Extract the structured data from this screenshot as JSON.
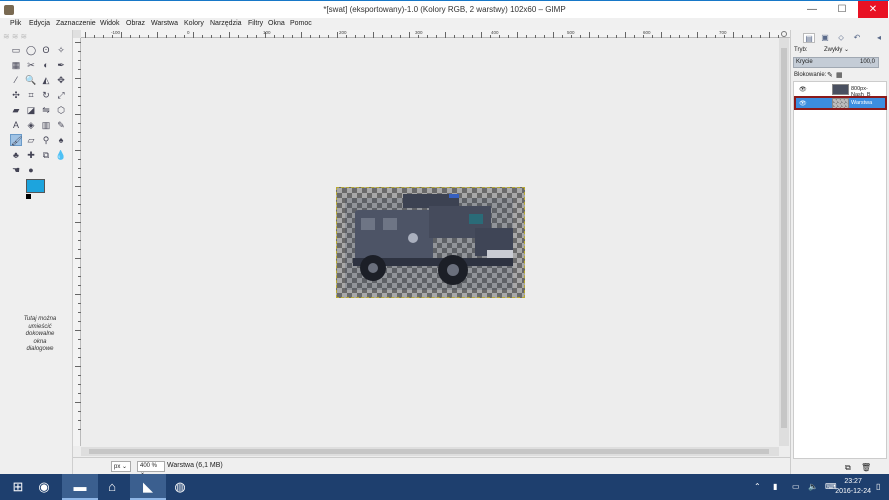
{
  "window": {
    "title": "*[swat] (eksportowany)-1.0 (Kolory RGB, 2 warstwy) 102x60 – GIMP",
    "minimize": "—",
    "maximize": "☐",
    "close": "✕"
  },
  "menu": [
    "Plik",
    "Edycja",
    "Zaznaczenie",
    "Widok",
    "Obraz",
    "Warstwa",
    "Kolory",
    "Narzędzia",
    "Filtry",
    "Okna",
    "Pomoc"
  ],
  "toolbox": {
    "tools": [
      {
        "name": "rect-select-icon",
        "glyph": "▭"
      },
      {
        "name": "ellipse-select-icon",
        "glyph": "◯"
      },
      {
        "name": "lasso-icon",
        "glyph": "ʘ"
      },
      {
        "name": "fuzzy-select-icon",
        "glyph": "✧"
      },
      {
        "name": "select-by-color-icon",
        "glyph": "▦"
      },
      {
        "name": "scissors-icon",
        "glyph": "✂"
      },
      {
        "name": "foreground-select-icon",
        "glyph": "◐"
      },
      {
        "name": "paths-icon",
        "glyph": "✒"
      },
      {
        "name": "color-picker-icon",
        "glyph": "⁄"
      },
      {
        "name": "zoom-icon",
        "glyph": "🔍"
      },
      {
        "name": "measure-icon",
        "glyph": "◭"
      },
      {
        "name": "move-icon",
        "glyph": "✥"
      },
      {
        "name": "align-icon",
        "glyph": "✣"
      },
      {
        "name": "crop-icon",
        "glyph": "⌗"
      },
      {
        "name": "rotate-icon",
        "glyph": "↻"
      },
      {
        "name": "scale-icon",
        "glyph": "⤢"
      },
      {
        "name": "shear-icon",
        "glyph": "▰"
      },
      {
        "name": "perspective-icon",
        "glyph": "◪"
      },
      {
        "name": "flip-icon",
        "glyph": "⇋"
      },
      {
        "name": "cage-icon",
        "glyph": "⬡"
      },
      {
        "name": "text-icon",
        "glyph": "A"
      },
      {
        "name": "bucket-fill-icon",
        "glyph": "◈"
      },
      {
        "name": "gradient-icon",
        "glyph": "▥"
      },
      {
        "name": "pencil-icon",
        "glyph": "✎"
      },
      {
        "name": "paintbrush-icon",
        "glyph": "🖌"
      },
      {
        "name": "eraser-icon",
        "glyph": "▱"
      },
      {
        "name": "airbrush-icon",
        "glyph": "⚲"
      },
      {
        "name": "ink-icon",
        "glyph": "♠"
      },
      {
        "name": "clone-icon",
        "glyph": "♣"
      },
      {
        "name": "heal-icon",
        "glyph": "✚"
      },
      {
        "name": "perspective-clone-icon",
        "glyph": "⧉"
      },
      {
        "name": "blur-icon",
        "glyph": "💧"
      },
      {
        "name": "smudge-icon",
        "glyph": "☚"
      },
      {
        "name": "dodge-burn-icon",
        "glyph": "●"
      }
    ],
    "dock_hint": "Tutaj można umieścić dokowalne okna dialogowe",
    "fg_color": "#1da4dd",
    "bg_color": "#ffffff"
  },
  "ruler": {
    "h_labels": [
      "-100",
      "0",
      "100",
      "200",
      "300",
      "400",
      "500",
      "600",
      "700"
    ]
  },
  "statusbar": {
    "unit": "px",
    "zoom": "400 %",
    "layer_info": "Warstwa (6,1 MB)"
  },
  "dock": {
    "mode_label": "Tryb:",
    "mode_value": "Zwykły",
    "opacity_label": "Krycie",
    "opacity_value": "100,0",
    "lock_label": "Blokowanie:",
    "layers": [
      {
        "name": "800px-Nash_B",
        "visible": true,
        "selected": false
      },
      {
        "name": "Warstwa",
        "visible": true,
        "selected": true
      }
    ]
  },
  "taskbar": {
    "time": "23:27",
    "date": "2016-12-24"
  }
}
